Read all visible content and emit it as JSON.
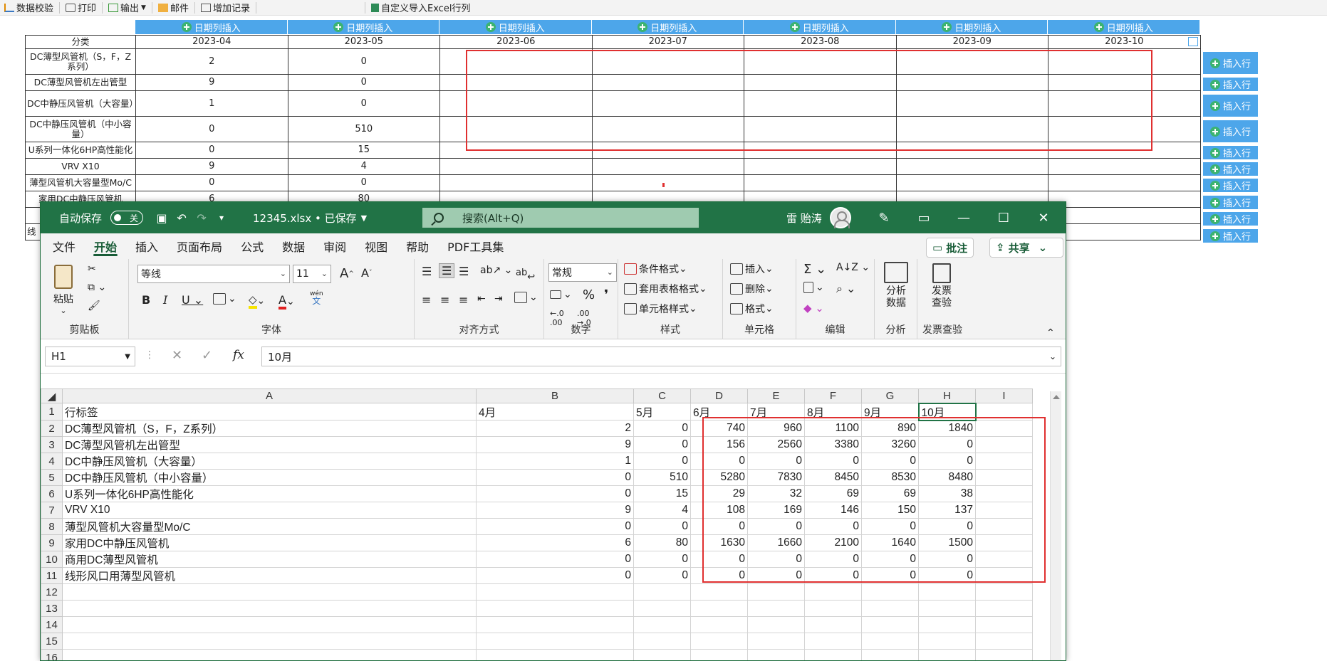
{
  "web": {
    "toolbar": {
      "validate": "数据校验",
      "print": "打印",
      "export": "输出",
      "mail": "邮件",
      "add_record": "增加记录",
      "import_excel": "自定义导入Excel行列"
    },
    "date_insert_label": "日期列插入",
    "category_header": "分类",
    "months": [
      "2023-04",
      "2023-05",
      "2023-06",
      "2023-07",
      "2023-08",
      "2023-09",
      "2023-10"
    ],
    "insert_row_label": "插入行",
    "rows": [
      {
        "cat": "DC薄型风管机（S，F，Z系列）",
        "v04": "2",
        "v05": "0"
      },
      {
        "cat": "DC薄型风管机左出管型",
        "v04": "9",
        "v05": "0"
      },
      {
        "cat": "DC中静压风管机（大容量）",
        "v04": "1",
        "v05": "0"
      },
      {
        "cat": "DC中静压风管机（中小容量）",
        "v04": "0",
        "v05": "510"
      },
      {
        "cat": "U系列一体化6HP高性能化",
        "v04": "0",
        "v05": "15"
      },
      {
        "cat": "VRV X10",
        "v04": "9",
        "v05": "4"
      },
      {
        "cat": "薄型风管机大容量型Mo/C",
        "v04": "0",
        "v05": "0"
      },
      {
        "cat": "家用DC中静压风管机",
        "v04": "6",
        "v05": "80"
      },
      {
        "cat": "",
        "v04": "",
        "v05": ""
      },
      {
        "cat": "线",
        "v04": "",
        "v05": ""
      }
    ]
  },
  "excel": {
    "autosave_label": "自动保存",
    "autosave_state": "关",
    "file_title": "12345.xlsx • 已保存",
    "search_placeholder": "搜索(Alt+Q)",
    "user_name": "雷 贻涛",
    "menus": [
      "文件",
      "开始",
      "插入",
      "页面布局",
      "公式",
      "数据",
      "审阅",
      "视图",
      "帮助",
      "PDF工具集"
    ],
    "active_menu": "开始",
    "comment_btn": "批注",
    "share_btn": "共享",
    "ribbon": {
      "paste": "粘贴",
      "clipboard": "剪贴板",
      "font_name": "等线",
      "font_size": "11",
      "font_group": "字体",
      "align_group": "对齐方式",
      "number_format": "常规",
      "number_group": "数字",
      "cond_format": "条件格式",
      "table_format": "套用表格格式",
      "cell_style": "单元格样式",
      "style_group": "样式",
      "insert": "插入",
      "delete": "删除",
      "format": "格式",
      "cells_group": "单元格",
      "edit_group": "编辑",
      "analyze": "分析数据",
      "analyze_line1": "分析",
      "analyze_line2": "数据",
      "analyze_group": "分析",
      "invoice_line1": "发票",
      "invoice_line2": "查验",
      "invoice_group": "发票查验",
      "wen_label": "wén",
      "wen_char": "文",
      "ab_char": "ab"
    },
    "name_box": "H1",
    "formula_value": "10月",
    "columns": [
      "A",
      "B",
      "C",
      "D",
      "E",
      "F",
      "G",
      "H",
      "I"
    ],
    "header_row": [
      "行标签",
      "4月",
      "5月",
      "6月",
      "7月",
      "8月",
      "9月",
      "10月"
    ],
    "data_rows": [
      [
        "DC薄型风管机（S，F，Z系列）",
        "2",
        "0",
        "740",
        "960",
        "1100",
        "890",
        "1840"
      ],
      [
        "DC薄型风管机左出管型",
        "9",
        "0",
        "156",
        "2560",
        "3380",
        "3260",
        "0"
      ],
      [
        "DC中静压风管机（大容量）",
        "1",
        "0",
        "0",
        "0",
        "0",
        "0",
        "0"
      ],
      [
        "DC中静压风管机（中小容量）",
        "0",
        "510",
        "5280",
        "7830",
        "8450",
        "8530",
        "8480"
      ],
      [
        "U系列一体化6HP高性能化",
        "0",
        "15",
        "29",
        "32",
        "69",
        "69",
        "38"
      ],
      [
        "VRV X10",
        "9",
        "4",
        "108",
        "169",
        "146",
        "150",
        "137"
      ],
      [
        "薄型风管机大容量型Mo/C",
        "0",
        "0",
        "0",
        "0",
        "0",
        "0",
        "0"
      ],
      [
        "家用DC中静压风管机",
        "6",
        "80",
        "1630",
        "1660",
        "2100",
        "1640",
        "1500"
      ],
      [
        "商用DC薄型风管机",
        "0",
        "0",
        "0",
        "0",
        "0",
        "0",
        "0"
      ],
      [
        "线形风口用薄型风管机",
        "0",
        "0",
        "0",
        "0",
        "0",
        "0",
        "0"
      ]
    ],
    "row_numbers": [
      "1",
      "2",
      "3",
      "4",
      "5",
      "6",
      "7",
      "8",
      "9",
      "10",
      "11",
      "12",
      "13",
      "14",
      "15",
      "16"
    ]
  }
}
